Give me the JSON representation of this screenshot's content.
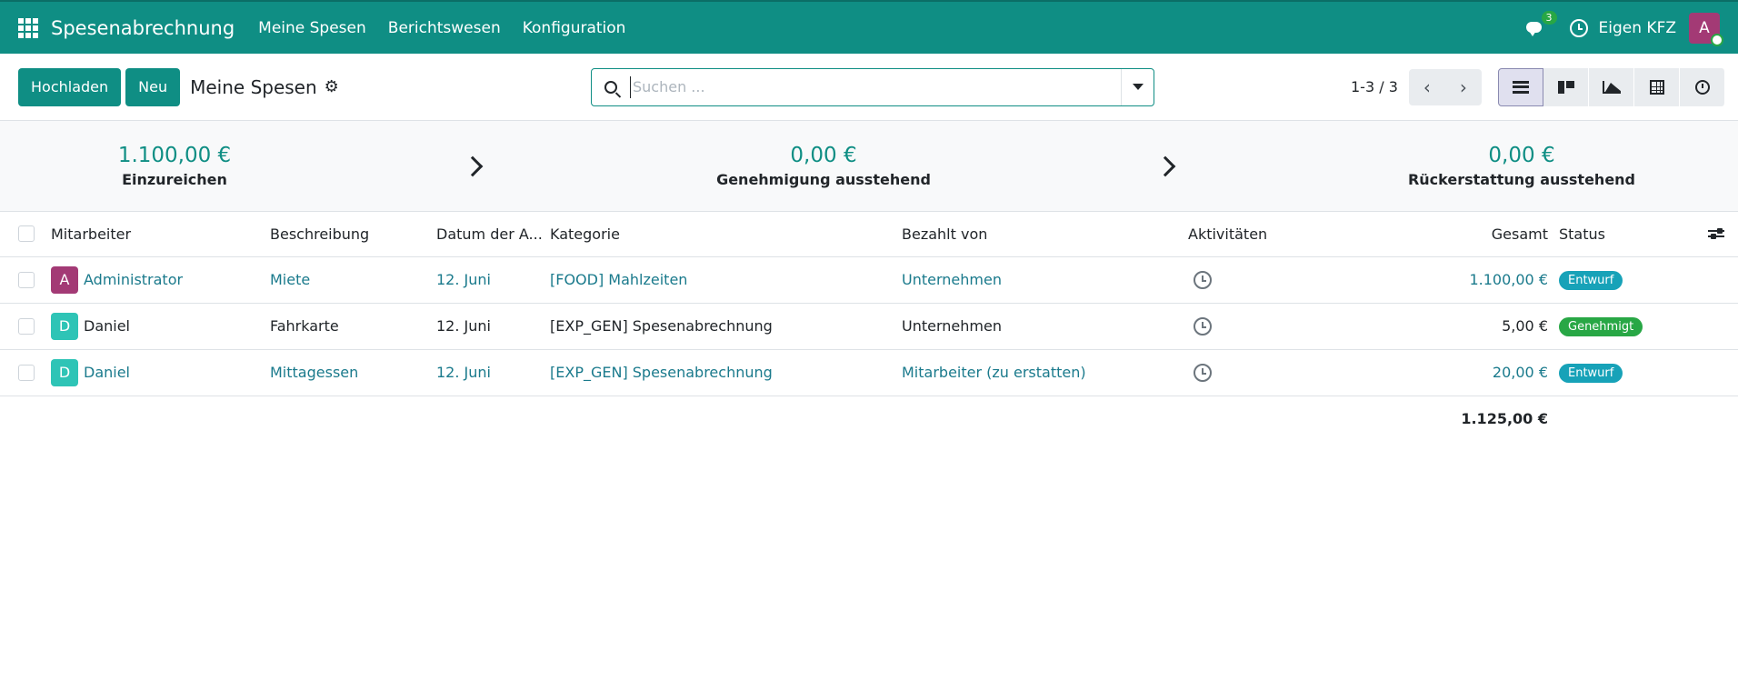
{
  "navbar": {
    "app_name": "Spesenabrechnung",
    "menu": [
      "Meine Spesen",
      "Berichtswesen",
      "Konfiguration"
    ],
    "chat_count": "3",
    "company": "Eigen KFZ",
    "user_initial": "A",
    "icons": [
      "apps-grid-icon",
      "chat-icon",
      "clock-icon"
    ]
  },
  "control": {
    "upload_label": "Hochladen",
    "new_label": "Neu",
    "breadcrumb": "Meine Spesen",
    "search_placeholder": "Suchen ...",
    "pager": "1-3 / 3",
    "views": [
      "list",
      "kanban",
      "graph",
      "pivot",
      "activity"
    ]
  },
  "stages": [
    {
      "amount": "1.100,00 €",
      "label": "Einzureichen"
    },
    {
      "amount": "0,00 €",
      "label": "Genehmigung ausstehend"
    },
    {
      "amount": "0,00 €",
      "label": "Rückerstattung ausstehend"
    }
  ],
  "table": {
    "headers": {
      "employee": "Mitarbeiter",
      "description": "Beschreibung",
      "date": "Datum der A...",
      "category": "Kategorie",
      "paid_by": "Bezahlt von",
      "activities": "Aktivitäten",
      "total": "Gesamt",
      "status": "Status"
    },
    "rows": [
      {
        "initial": "A",
        "avatar_color": "#a33a75",
        "employee": "Administrator",
        "description": "Miete",
        "date": "12. Juni",
        "category": "[FOOD] Mahlzeiten",
        "paid_by": "Unternehmen",
        "total": "1.100,00 €",
        "status": "Entwurf",
        "status_color": "#17a2b8",
        "linked": true
      },
      {
        "initial": "D",
        "avatar_color": "#2ec4b6",
        "employee": "Daniel",
        "description": "Fahrkarte",
        "date": "12. Juni",
        "category": "[EXP_GEN] Spesenabrechnung",
        "paid_by": "Unternehmen",
        "total": "5,00 €",
        "status": "Genehmigt",
        "status_color": "#28a745",
        "linked": false
      },
      {
        "initial": "D",
        "avatar_color": "#2ec4b6",
        "employee": "Daniel",
        "description": "Mittagessen",
        "date": "12. Juni",
        "category": "[EXP_GEN] Spesenabrechnung",
        "paid_by": "Mitarbeiter (zu erstatten)",
        "total": "20,00 €",
        "status": "Entwurf",
        "status_color": "#17a2b8",
        "linked": true
      }
    ],
    "grand_total": "1.125,00 €"
  },
  "colors": {
    "brand": "#0f8e84",
    "link": "#1a7a8c"
  }
}
